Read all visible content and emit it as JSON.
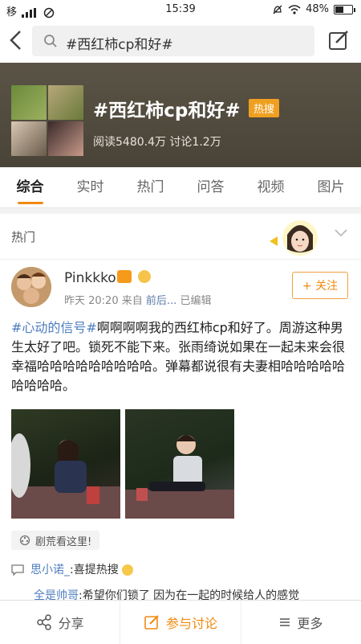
{
  "status_bar": {
    "carrier": "移",
    "time": "15:39",
    "battery": "48%"
  },
  "search": {
    "query": "#西红柿cp和好#"
  },
  "hero": {
    "title": "#西红柿cp和好#",
    "badge": "热搜",
    "stats": "阅读5480.4万 讨论1.2万"
  },
  "tabs": [
    "综合",
    "实时",
    "热门",
    "问答",
    "视频",
    "图片"
  ],
  "section": {
    "header": "热门"
  },
  "post": {
    "username": "Pinkkko",
    "time": "昨天 20:20",
    "from_label": "来自",
    "source": "前后...",
    "edited": "已编辑",
    "follow_label": "+ 关注",
    "topic": "#心动的信号#",
    "text": "啊啊啊啊我的西红柿cp和好了。周游这种男生太好了吧。锁死不能下来。张雨绮说如果在一起未来会很幸福哈哈哈哈哈哈哈哈哈。弹幕都说很有夫妻相哈哈哈哈哈哈哈哈哈。",
    "pill": "剧荒看这里!"
  },
  "comments": [
    {
      "name": "思小诺_",
      "text": ":喜提热搜"
    },
    {
      "name": "全是帅哥",
      "text": ":希望你们锁了 因为在一起的时候给人的感觉"
    }
  ],
  "bottom_bar": {
    "share": "分享",
    "discuss": "参与讨论",
    "more": "更多"
  },
  "colors": {
    "accent": "#f08a10",
    "link": "#4e7ec0"
  }
}
